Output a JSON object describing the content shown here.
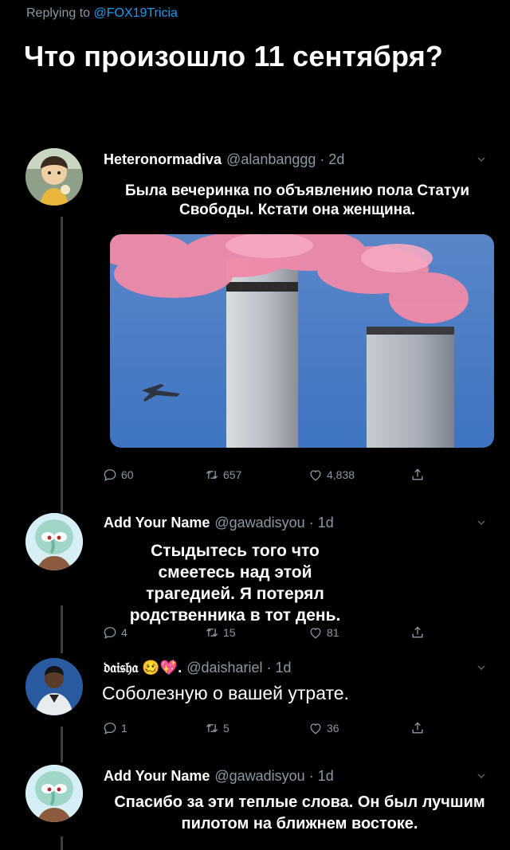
{
  "header": {
    "replying_prefix": "Replying to",
    "replying_handle": "@FOX19Tricia",
    "title": "Что произошло 11 сентября?"
  },
  "tweets": [
    {
      "name": "Heteronormadiva",
      "meta": "@alanbanggg · 2d",
      "text": "Была вечеринка по объявлению пола Статуи Свободы. Кстати она женщина.",
      "replies": "60",
      "retweets": "657",
      "likes": "4,838"
    },
    {
      "name": "Add Your Name",
      "meta": "@gawadisyou · 1d",
      "text": "Стыдытесь того что смеетесь над этой трагедией. Я потерял родственника в тот день.",
      "replies": "4",
      "retweets": "15",
      "likes": "81"
    },
    {
      "name": "𝔡𝔞𝔦𝔰𝔥𝔞 🥴💖.",
      "meta": "@daishariel · 1d",
      "text": "Соболезную о вашей утрате.",
      "replies": "1",
      "retweets": "5",
      "likes": "36"
    },
    {
      "name": "Add Your Name",
      "meta": "@gawadisyou · 1d",
      "text": "Спасибо за эти теплые слова. Он был лучшим пилотом на ближнем востоке."
    }
  ],
  "icons": [
    "reply-icon",
    "retweet-icon",
    "like-icon",
    "share-icon",
    "chevron-down-icon"
  ],
  "colors": {
    "background": "#000000",
    "muted": "#8b98a5",
    "link": "#1d9bf0",
    "thread": "#3a3f44"
  }
}
